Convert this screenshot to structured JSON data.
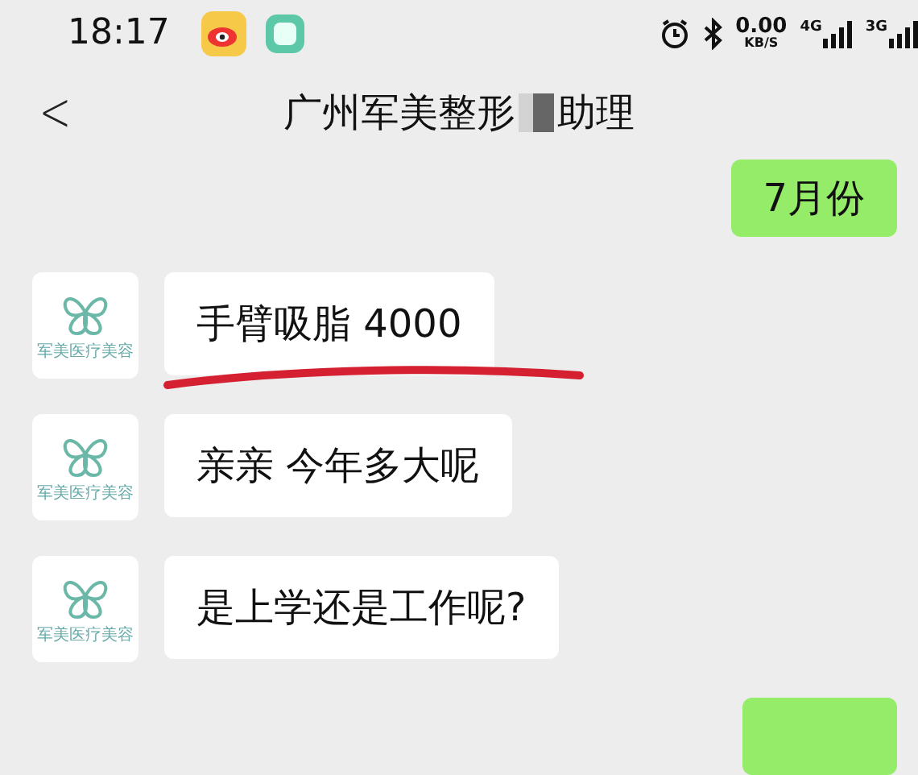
{
  "status_bar": {
    "time": "18:17",
    "net_speed": "0.00",
    "net_unit": "KB/S",
    "networks": [
      "4G",
      "3G"
    ]
  },
  "header": {
    "back": "<",
    "title_before": "广州军美整形",
    "title_after": "助理"
  },
  "messages": [
    {
      "kind": "sent",
      "text": "7月份"
    },
    {
      "kind": "received",
      "text": "手臂吸脂 4000",
      "underlined": true,
      "avatar_caption": "军美医疗美容"
    },
    {
      "kind": "received",
      "text": "亲亲 今年多大呢",
      "underlined": false,
      "avatar_caption": "军美医疗美容"
    },
    {
      "kind": "received",
      "text": "是上学还是工作呢?",
      "underlined": false,
      "avatar_caption": "军美医疗美容"
    },
    {
      "kind": "sent"
    }
  ]
}
